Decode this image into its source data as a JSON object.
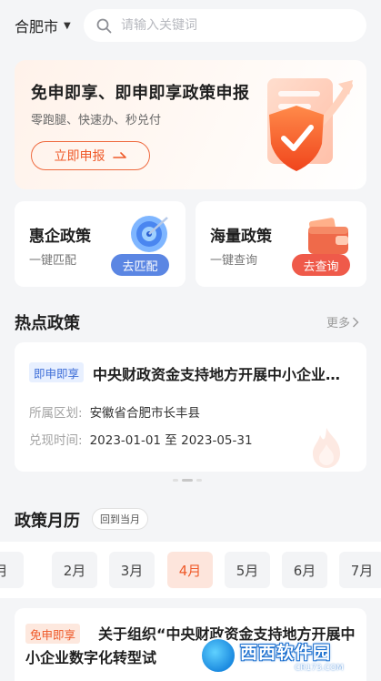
{
  "header": {
    "city": "合肥市",
    "city_caret_icon": "caret-down-icon",
    "search_placeholder": "请输入关键词",
    "search_icon": "search-icon"
  },
  "banner": {
    "title": "免申即享、即申即享政策申报",
    "subtitle": "零跑腿、快速办、秒兑付",
    "button_label": "立即申报",
    "button_icon": "arrow-right-icon",
    "accent_color": "#ef5a2a"
  },
  "cards": [
    {
      "title": "惠企政策",
      "subtitle": "一键匹配",
      "tag": "去匹配",
      "icon": "target-icon",
      "tag_color": "#5b86e3"
    },
    {
      "title": "海量政策",
      "subtitle": "一键查询",
      "tag": "去查询",
      "icon": "wallet-icon",
      "tag_color": "#ef5a4a"
    }
  ],
  "hot": {
    "section_title": "热点政策",
    "more_label": "更多",
    "badge": "即申即享",
    "title": "中央财政资金支持地方开展中小企业数字化转型试点",
    "region_label": "所属区划:",
    "region_value": "安徽省合肥市长丰县",
    "time_label": "兑现时间:",
    "time_value": "2023-01-01 至 2023-05-31"
  },
  "calendar": {
    "section_title": "政策月历",
    "back_label": "回到当月",
    "months": [
      "月",
      "2月",
      "3月",
      "4月",
      "5月",
      "6月",
      "7月"
    ],
    "active_month": "4月"
  },
  "bottom": {
    "badge": "免申即享",
    "title": "关于组织“中央财政资金支持地方开展中小企业数字化转型试"
  },
  "watermark": {
    "main": "西西软件园",
    "url": "CR173.COM"
  }
}
